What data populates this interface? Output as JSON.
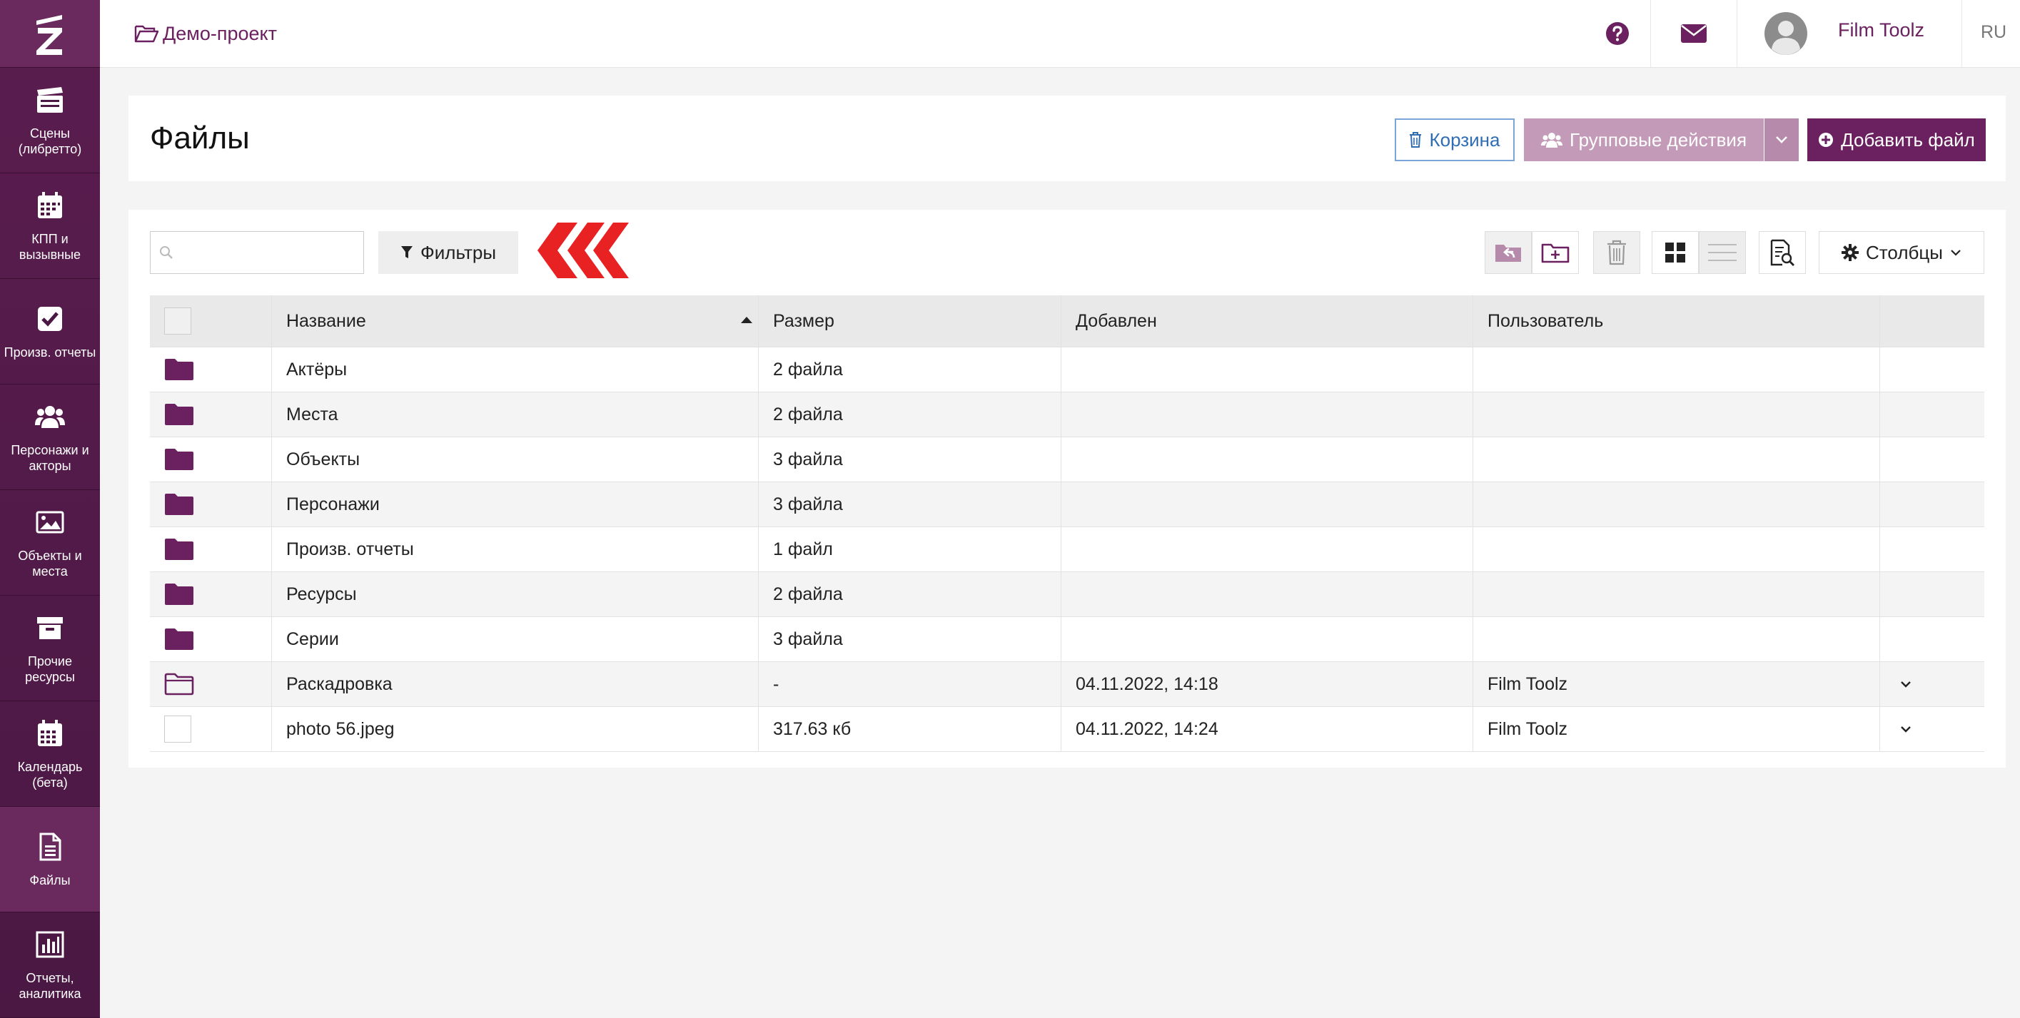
{
  "sidebar": {
    "items": [
      {
        "label": "Сцены\n(либретто)",
        "icon": "clapperboard-icon"
      },
      {
        "label": "КПП и\nвызывные",
        "icon": "calendar-icon"
      },
      {
        "label": "Произв. отчеты",
        "icon": "checkbox-icon"
      },
      {
        "label": "Персонажи и\nакторы",
        "icon": "users-icon"
      },
      {
        "label": "Объекты и\nместа",
        "icon": "image-icon"
      },
      {
        "label": "Прочие\nресурсы",
        "icon": "archive-icon"
      },
      {
        "label": "Календарь\n(бета)",
        "icon": "calendar-grid-icon"
      },
      {
        "label": "Файлы",
        "icon": "file-icon"
      },
      {
        "label": "Отчеты,\nаналитика",
        "icon": "bar-chart-icon"
      }
    ]
  },
  "topbar": {
    "project": "Демо-проект",
    "user_name": "Film Toolz",
    "lang": "RU"
  },
  "header": {
    "title": "Файлы",
    "trash_label": "Корзина",
    "group_actions_label": "Групповые действия",
    "add_file_label": "Добавить файл"
  },
  "toolbar": {
    "search_placeholder": "",
    "filters_label": "Фильтры",
    "columns_label": "Столбцы"
  },
  "table": {
    "columns": [
      "Название",
      "Размер",
      "Добавлен",
      "Пользователь"
    ],
    "rows": [
      {
        "type": "folder",
        "name": "Актёры",
        "size": "2 файла",
        "added": "",
        "user": ""
      },
      {
        "type": "folder",
        "name": "Места",
        "size": "2 файла",
        "added": "",
        "user": ""
      },
      {
        "type": "folder",
        "name": "Объекты",
        "size": "3 файла",
        "added": "",
        "user": ""
      },
      {
        "type": "folder",
        "name": "Персонажи",
        "size": "3 файла",
        "added": "",
        "user": ""
      },
      {
        "type": "folder",
        "name": "Произв. отчеты",
        "size": "1 файл",
        "added": "",
        "user": ""
      },
      {
        "type": "folder",
        "name": "Ресурсы",
        "size": "2 файла",
        "added": "",
        "user": ""
      },
      {
        "type": "folder",
        "name": "Серии",
        "size": "3 файла",
        "added": "",
        "user": ""
      },
      {
        "type": "folder-outline",
        "name": "Раскадровка",
        "size": "-",
        "added": "04.11.2022, 14:18",
        "user": "Film Toolz"
      },
      {
        "type": "file",
        "name": "photo 56.jpeg",
        "size": "317.63 кб",
        "added": "04.11.2022, 14:24",
        "user": "Film Toolz"
      }
    ]
  },
  "colors": {
    "brand": "#6b2060",
    "sidebar": "#4a1843",
    "accent_red": "#e82222"
  }
}
